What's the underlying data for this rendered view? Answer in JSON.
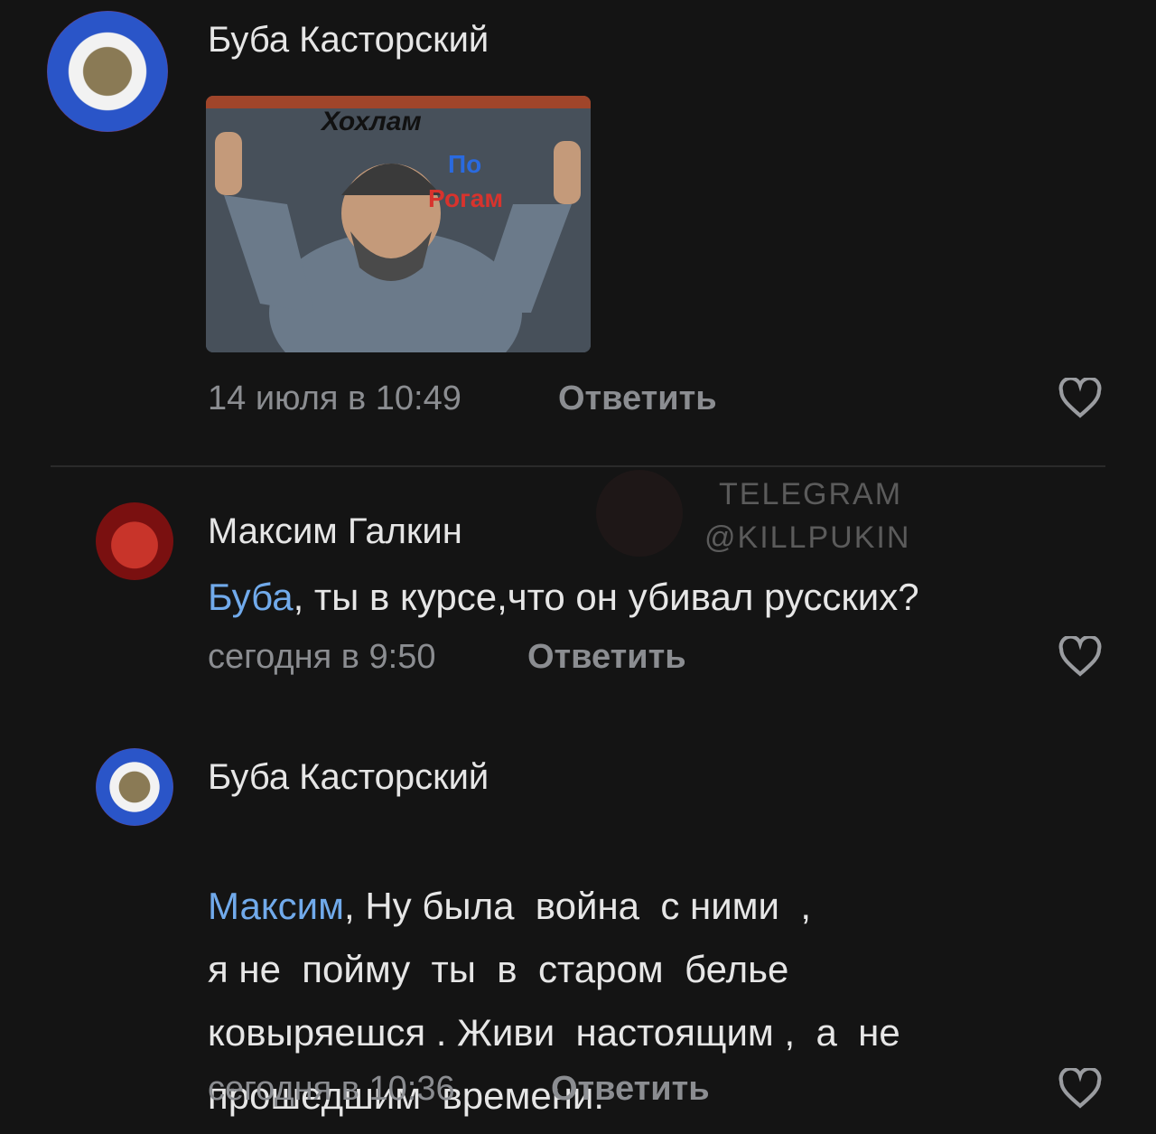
{
  "comments": [
    {
      "author": "Буба Касторский",
      "image_caption_line1": "Хохлам",
      "image_caption_line2": "По",
      "image_caption_line3": "Рогам",
      "date": "14 июля в 10:49",
      "reply_label": "Ответить"
    },
    {
      "author": "Максим Галкин",
      "mention": "Буба",
      "text": ", ты в курсе,что он убивал русских?",
      "date": "сегодня в 9:50",
      "reply_label": "Ответить"
    },
    {
      "author": "Буба Касторский",
      "mention": "Максим",
      "line1": ", Ну была  война  с ними  ,",
      "line2": "я не  пойму  ты  в  старом  белье",
      "line3": "ковыряешся . Живи  настоящим ,  а  не",
      "line4": "прошедшим  времени.",
      "date": "сегодня в 10:36",
      "reply_label": "Ответить"
    }
  ],
  "watermark": {
    "line1": "TELEGRAM",
    "line2": "@KILLPUKIN"
  },
  "icons": {
    "like": "heart-icon"
  },
  "colors": {
    "background": "#141414",
    "mention": "#71aaeb",
    "meta": "#8b8d91"
  }
}
